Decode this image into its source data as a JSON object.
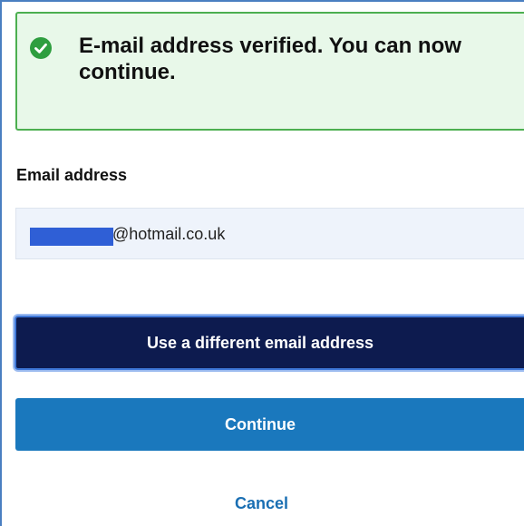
{
  "alert": {
    "message": "E-mail address verified. You can now continue.",
    "icon": "check-circle-icon",
    "color": "#4caf50"
  },
  "email": {
    "label": "Email address",
    "domain_suffix": "@hotmail.co.uk"
  },
  "buttons": {
    "different_email": "Use a different email address",
    "continue": "Continue",
    "cancel": "Cancel"
  },
  "colors": {
    "navy_button": "#0d1b4f",
    "blue_button": "#1a78bd",
    "link": "#1a6fb3",
    "input_bg": "#eef3fb"
  }
}
